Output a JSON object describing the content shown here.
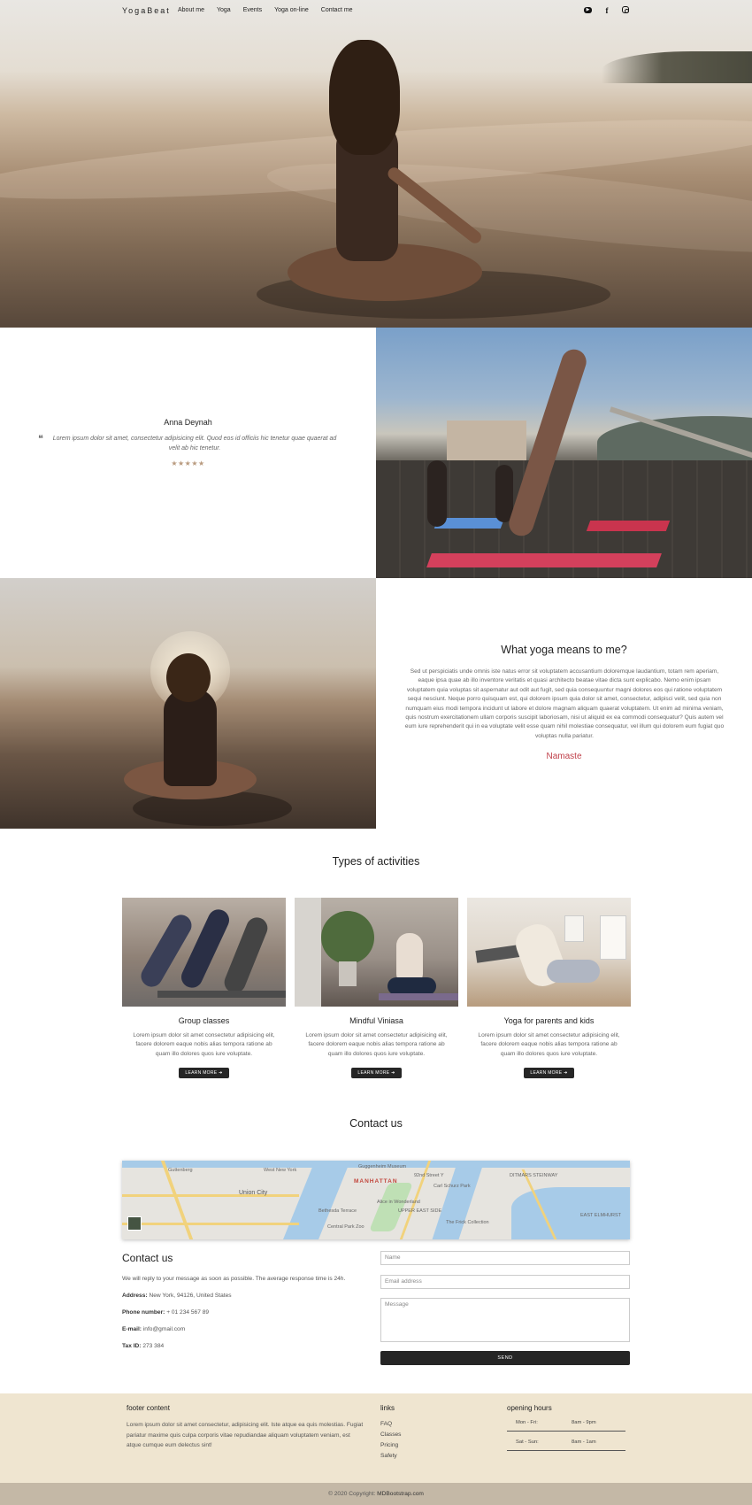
{
  "nav": {
    "brand": "YogaBeat",
    "links": [
      "About me",
      "Yoga",
      "Events",
      "Yoga on-line",
      "Contact me"
    ]
  },
  "social_icons": [
    "youtube-icon",
    "facebook-icon",
    "instagram-icon"
  ],
  "testimonial": {
    "name": "Anna Deynah",
    "quote": "Lorem ipsum dolor sit amet, consectetur adipisicing elit. Quod eos id officiis hic tenetur quae quaerat ad velit ab hic tenetur.",
    "rating": 5
  },
  "meaning": {
    "title": "What yoga means to me?",
    "text": "Sed ut perspiciatis unde omnis iste natus error sit voluptatem accusantium doloremque laudantium, totam rem aperiam, eaque ipsa quae ab illo inventore veritatis et quasi architecto beatae vitae dicta sunt explicabo. Nemo enim ipsam voluptatem quia voluptas sit aspernatur aut odit aut fugit, sed quia consequuntur magni dolores eos qui ratione voluptatem sequi nesciunt. Neque porro quisquam est, qui dolorem ipsum quia dolor sit amet, consectetur, adipisci velit, sed quia non numquam eius modi tempora incidunt ut labore et dolore magnam aliquam quaerat voluptatem. Ut enim ad minima veniam, quis nostrum exercitationem ullam corporis suscipit laboriosam, nisi ut aliquid ex ea commodi consequatur? Quis autem vel eum iure reprehenderit qui in ea voluptate velit esse quam nihil molestiae consequatur, vel illum qui dolorem eum fugiat quo voluptas nulla pariatur.",
    "signature": "Namaste"
  },
  "activities": {
    "title": "Types of activities",
    "cards": [
      {
        "title": "Group classes",
        "text": "Lorem ipsum dolor sit amet consectetur adipisicing elit, facere dolorem eaque nobis alias tempora ratione ab quam illo dolores quos iure voluptate.",
        "button": "LEARN MORE"
      },
      {
        "title": "Mindful Viniasa",
        "text": "Lorem ipsum dolor sit amet consectetur adipisicing elit, facere dolorem eaque nobis alias tempora ratione ab quam illo dolores quos iure voluptate.",
        "button": "LEARN MORE"
      },
      {
        "title": "Yoga for parents and kids",
        "text": "Lorem ipsum dolor sit amet consectetur adipisicing elit, facere dolorem eaque nobis alias tempora ratione ab quam illo dolores quos iure voluptate.",
        "button": "LEARN MORE"
      }
    ]
  },
  "contact": {
    "section_title": "Contact us",
    "map_labels": [
      "Guttenberg",
      "West New York",
      "Union City",
      "Guggenheim Museum",
      "MANHATTAN",
      "92nd Street Y",
      "Carl Schurz Park",
      "Alice in Wonderland",
      "UPPER EAST SIDE",
      "Bethesda Terrace",
      "Central Park Zoo",
      "The Frick Collection",
      "DITMARS STEINWAY",
      "EAST ELMHURST"
    ],
    "heading": "Contact us",
    "message": "We will reply to your message as soon as possible. The average response time is 24h.",
    "rows": [
      {
        "label": "Address:",
        "value": "New York, 94126, United States"
      },
      {
        "label": "Phone number:",
        "value": "+ 01 234 567 89"
      },
      {
        "label": "E-mail:",
        "value": "info@gmail.com"
      },
      {
        "label": "Tax ID:",
        "value": "273 384"
      }
    ],
    "form": {
      "name_placeholder": "Name",
      "email_placeholder": "Email address",
      "message_placeholder": "Message",
      "send_label": "SEND"
    }
  },
  "footer": {
    "content_title": "footer content",
    "content_text": "Lorem ipsum dolor sit amet consectetur, adipisicing elit. Iste atque ea quis molestias. Fugiat pariatur maxime quis culpa corporis vitae repudiandae aliquam voluptatem veniam, est atque cumque eum delectus sint!",
    "links_title": "links",
    "links": [
      "FAQ",
      "Classes",
      "Pricing",
      "Safety"
    ],
    "hours_title": "opening hours",
    "hours": [
      {
        "days": "Mon - Fri:",
        "time": "8am - 9pm"
      },
      {
        "days": "Sat - Sun:",
        "time": "8am - 1am"
      }
    ],
    "copyright_prefix": "© 2020 Copyright:",
    "copyright_link": "MDBootstrap.com"
  },
  "colors": {
    "accent_signature": "#c0404a",
    "footer_bg": "#efe5d0",
    "copyright_bg": "#c4b8a6",
    "button_bg": "#262626",
    "stars": "#b89a7e"
  }
}
